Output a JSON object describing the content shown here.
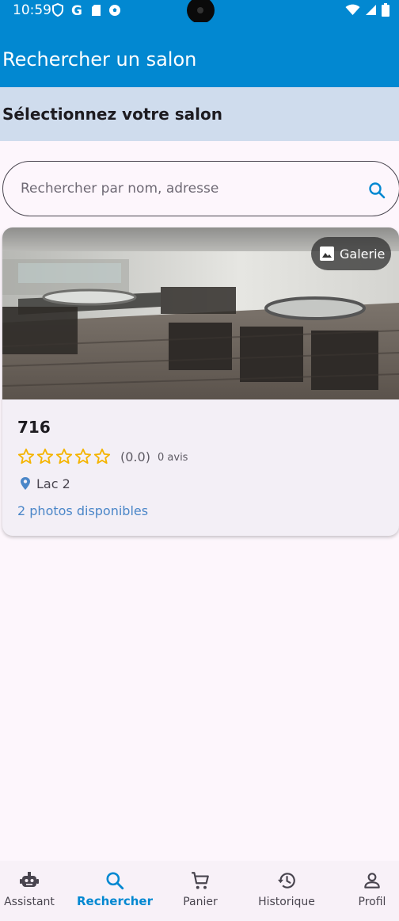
{
  "status_bar": {
    "time": "10:59",
    "left_icons": [
      "shield-icon",
      "google-g-icon",
      "sd-card-icon",
      "soccer-ball-icon"
    ],
    "right_icons": [
      "wifi-icon",
      "signal-icon",
      "battery-icon"
    ]
  },
  "app_bar": {
    "title": "Rechercher un salon"
  },
  "section": {
    "title": "Sélectionnez votre salon"
  },
  "search": {
    "placeholder": "Rechercher par nom, adresse",
    "value": ""
  },
  "salon_card": {
    "name": "716",
    "gallery_label": "Galerie",
    "star_count": 5,
    "rating_value": 0.0,
    "rating_text": "(0.0)",
    "reviews_text": "0 avis",
    "location": "Lac 2",
    "photos_text": "2 photos disponibles",
    "image_description": "outdoor hot tubs and lounge chairs on a wooden deck by the lake"
  },
  "colors": {
    "primary": "#0288d1",
    "section_bg": "#cfdced",
    "star": "#f4b400",
    "link": "#4a86c8",
    "background": "#fdf6fc"
  },
  "bottom_nav": {
    "items": [
      {
        "label": "Assistant",
        "icon": "robot-icon"
      },
      {
        "label": "Rechercher",
        "icon": "search-icon",
        "active": true
      },
      {
        "label": "Panier",
        "icon": "cart-icon"
      },
      {
        "label": "Historique",
        "icon": "history-icon"
      },
      {
        "label": "Profil",
        "icon": "person-icon"
      }
    ]
  }
}
